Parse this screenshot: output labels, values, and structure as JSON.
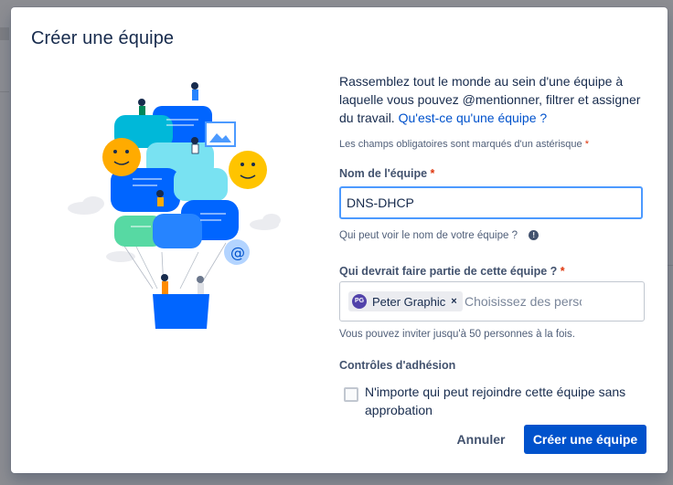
{
  "modal": {
    "title": "Créer une équipe",
    "intro_text": "Rassemblez tout le monde au sein d'une équipe à laquelle vous pouvez @mentionner, filtrer et assigner du travail.",
    "intro_link": "Qu'est-ce qu'une équipe ?",
    "required_note": "Les champs obligatoires sont marqués d'un astérisque",
    "asterisk": "*",
    "team_name": {
      "label": "Nom de l'équipe",
      "value": "DNS-DHCP",
      "helper": "Qui peut voir le nom de votre équipe ?"
    },
    "members": {
      "label": "Qui devrait faire partie de cette équipe ?",
      "chip_initials": "PG",
      "chip_label": "Peter Graphic",
      "chip_remove": "×",
      "placeholder": "Choisissez des personnes",
      "helper": "Vous pouvez inviter jusqu'à 50 personnes à la fois."
    },
    "membership": {
      "label": "Contrôles d'adhésion",
      "checkbox_label": "N'importe qui peut rejoindre cette équipe sans approbation",
      "checked": false
    },
    "buttons": {
      "cancel": "Annuler",
      "create": "Créer une équipe"
    },
    "info_icon_glyph": "!"
  },
  "colors": {
    "primary": "#0052cc",
    "focus_border": "#4c9aff",
    "required": "#de350b",
    "text": "#172b4d"
  }
}
